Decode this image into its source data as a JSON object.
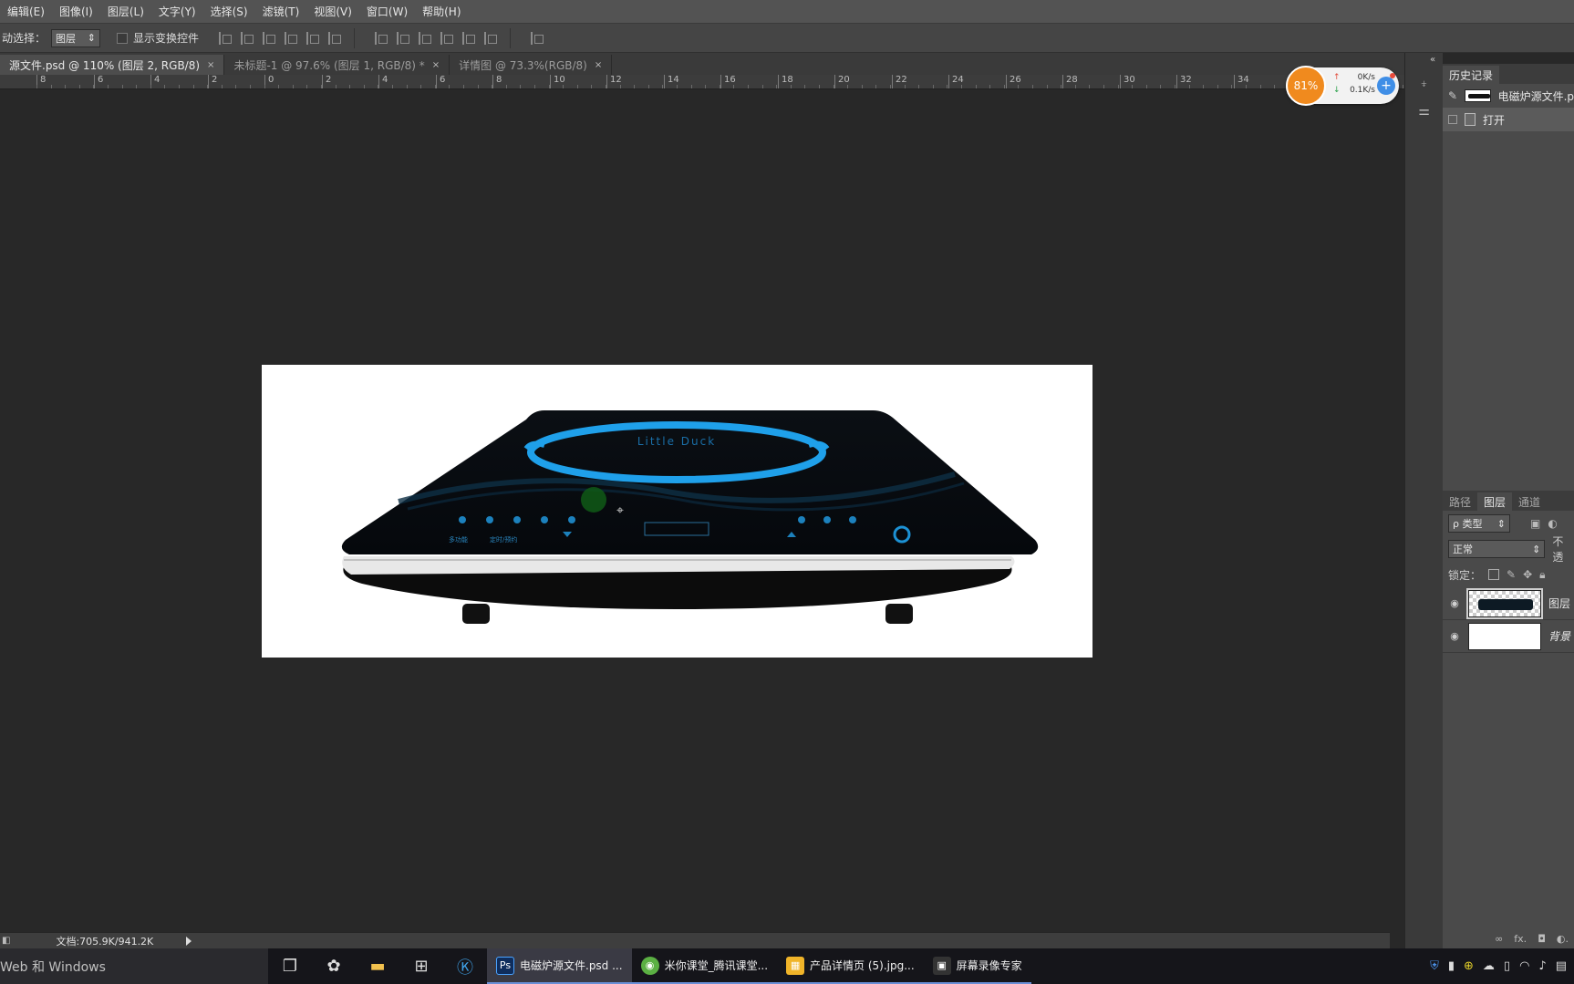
{
  "menu": {
    "items": [
      "编辑(E)",
      "图像(I)",
      "图层(L)",
      "文字(Y)",
      "选择(S)",
      "滤镜(T)",
      "视图(V)",
      "窗口(W)",
      "帮助(H)"
    ]
  },
  "options": {
    "auto_select_label": "动选择：",
    "auto_select_value": "图层",
    "show_transform_label": "显示变换控件"
  },
  "tabs": [
    {
      "label": "源文件.psd @ 110% (图层 2, RGB/8)",
      "close": "×"
    },
    {
      "label": "未标题-1 @ 97.6% (图层 1, RGB/8) *",
      "close": "×"
    },
    {
      "label": "详情图 @ 73.3%(RGB/8)",
      "close": "×"
    }
  ],
  "ruler": {
    "labels": [
      "8",
      "6",
      "4",
      "2",
      "0",
      "2",
      "4",
      "6",
      "8",
      "10",
      "12",
      "14",
      "16",
      "18",
      "20",
      "22",
      "24",
      "26",
      "28",
      "30",
      "32",
      "34"
    ]
  },
  "network_widget": {
    "percent": "81%",
    "upload": "0K/s",
    "download": "0.1K/s",
    "up_arrow": "↑",
    "down_arrow": "↓",
    "plus": "+"
  },
  "history_panel": {
    "tab": "历史记录",
    "snapshot_name": "电磁炉源文件.p",
    "entries": [
      "打开"
    ]
  },
  "layers_panel": {
    "tabs": [
      "路径",
      "图层",
      "通道"
    ],
    "filter_label": "ρ 类型",
    "blend_mode": "正常",
    "opacity_label": "不透",
    "lock_label": "锁定：",
    "layers": [
      {
        "name": "图层"
      },
      {
        "name": "背景"
      }
    ],
    "bottom_icons": [
      "∞",
      "fx.",
      "◘",
      "◐."
    ]
  },
  "statusbar": {
    "doc_info": "文档:705.9K/941.2K"
  },
  "taskbar": {
    "search": "Web 和 Windows",
    "apps": [
      {
        "badge": "Ps",
        "label": "电磁炉源文件.psd ..."
      },
      {
        "badge": "◉",
        "label": "米你课堂_腾讯课堂..."
      },
      {
        "badge": "▦",
        "label": "产品详情页 (5).jpg..."
      },
      {
        "badge": "▣",
        "label": "屏幕录像专家"
      }
    ]
  },
  "product": {
    "brand": "Little Duck",
    "badge_left": "多功能",
    "badge_mid": "定时/预约"
  }
}
